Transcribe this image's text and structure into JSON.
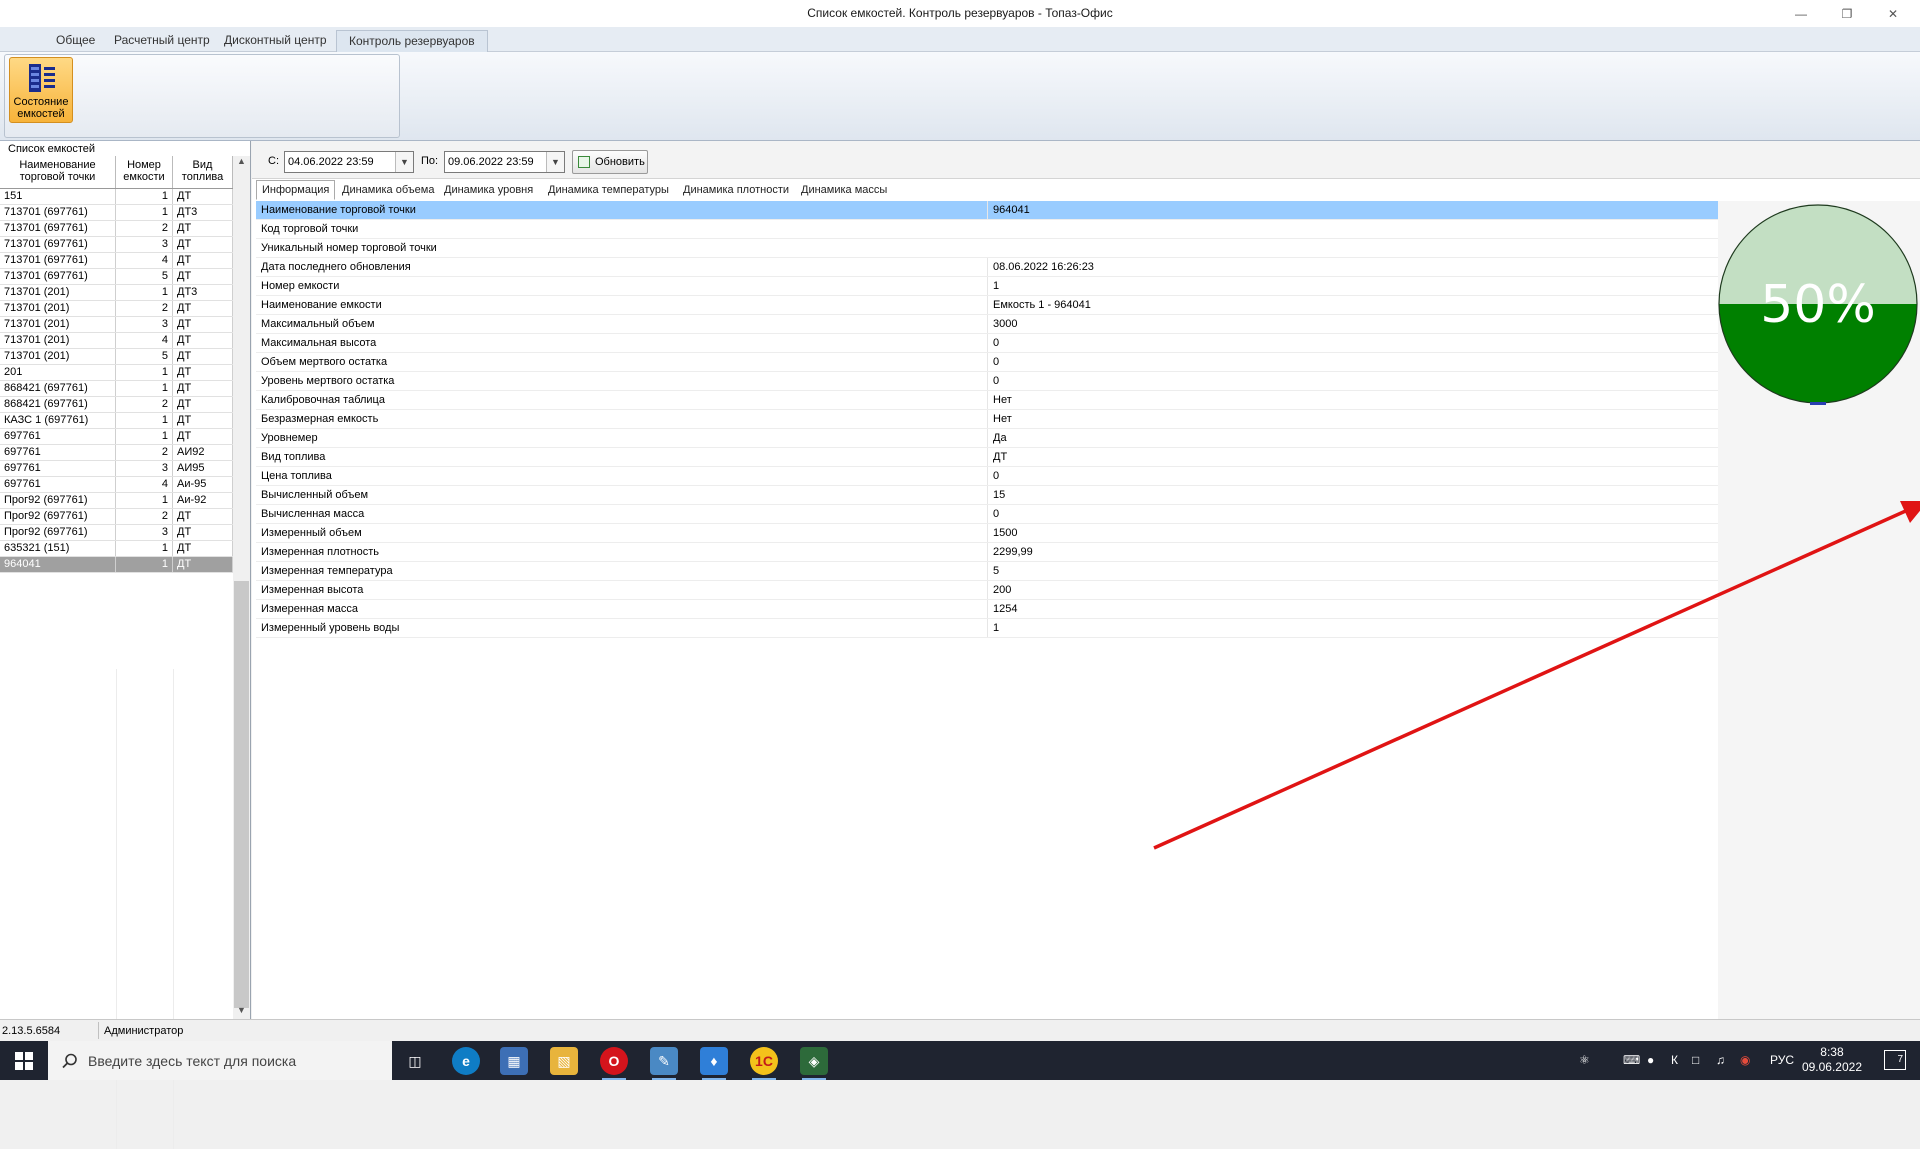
{
  "window": {
    "title": "Список емкостей. Контроль резервуаров - Топаз-Офис"
  },
  "ribbon_tabs": [
    "Общее",
    "Расчетный центр",
    "Дисконтный центр",
    "Контроль резервуаров"
  ],
  "ribbon": {
    "state_button": "Состояние емкостей"
  },
  "tank_list": {
    "caption": "Список емкостей",
    "headers": [
      "Наименование торговой точки",
      "Номер емкости",
      "Вид топлива"
    ],
    "rows": [
      [
        "151",
        "1",
        "ДТ"
      ],
      [
        "713701 (697761)",
        "1",
        "ДТ3"
      ],
      [
        "713701 (697761)",
        "2",
        "ДТ"
      ],
      [
        "713701 (697761)",
        "3",
        "ДТ"
      ],
      [
        "713701 (697761)",
        "4",
        "ДТ"
      ],
      [
        "713701 (697761)",
        "5",
        "ДТ"
      ],
      [
        "713701 (201)",
        "1",
        "ДТ3"
      ],
      [
        "713701 (201)",
        "2",
        "ДТ"
      ],
      [
        "713701 (201)",
        "3",
        "ДТ"
      ],
      [
        "713701 (201)",
        "4",
        "ДТ"
      ],
      [
        "713701 (201)",
        "5",
        "ДТ"
      ],
      [
        "201",
        "1",
        "ДТ"
      ],
      [
        "868421 (697761)",
        "1",
        "ДТ"
      ],
      [
        "868421 (697761)",
        "2",
        "ДТ"
      ],
      [
        "КАЗС 1 (697761)",
        "1",
        "ДТ"
      ],
      [
        "697761",
        "1",
        "ДТ"
      ],
      [
        "697761",
        "2",
        "АИ92"
      ],
      [
        "697761",
        "3",
        "АИ95"
      ],
      [
        "697761",
        "4",
        "Аи-95"
      ],
      [
        "Прог92 (697761)",
        "1",
        "Аи-92"
      ],
      [
        "Прог92 (697761)",
        "2",
        "ДТ"
      ],
      [
        "Прог92 (697761)",
        "3",
        "ДТ"
      ],
      [
        "635321 (151)",
        "1",
        "ДТ"
      ],
      [
        "964041",
        "1",
        "ДТ"
      ]
    ],
    "selected_index": 23
  },
  "filter": {
    "from_label": "С:",
    "from_value": "04.06.2022 23:59",
    "to_label": "По:",
    "to_value": "09.06.2022 23:59",
    "refresh_label": "Обновить"
  },
  "info_tabs": [
    "Информация",
    "Динамика объема",
    "Динамика уровня",
    "Динамика температуры",
    "Динамика плотности",
    "Динамика массы"
  ],
  "properties": [
    [
      "Наименование торговой точки",
      "964041"
    ],
    [
      "Код торговой точки",
      ""
    ],
    [
      "Уникальный номер торговой точки",
      ""
    ],
    [
      "Дата последнего обновления",
      "08.06.2022 16:26:23"
    ],
    [
      "Номер емкости",
      "1"
    ],
    [
      "Наименование емкости",
      "Емкость 1 - 964041"
    ],
    [
      "Максимальный объем",
      "3000"
    ],
    [
      "Максимальная высота",
      "0"
    ],
    [
      "Объем мертвого остатка",
      "0"
    ],
    [
      "Уровень мертвого остатка",
      "0"
    ],
    [
      "Калибровочная таблица",
      "Нет"
    ],
    [
      "Безразмерная емкость",
      "Нет"
    ],
    [
      "Уровнемер",
      "Да"
    ],
    [
      "Вид топлива",
      "ДТ"
    ],
    [
      "Цена топлива",
      "0"
    ],
    [
      "Вычисленный объем",
      "15"
    ],
    [
      "Вычисленная масса",
      "0"
    ],
    [
      "Измеренный объем",
      "1500"
    ],
    [
      "Измеренная плотность",
      "2299,99"
    ],
    [
      "Измеренная температура",
      "5"
    ],
    [
      "Измеренная высота",
      "200"
    ],
    [
      "Измеренная масса",
      "1254"
    ],
    [
      "Измеренный уровень воды",
      "1"
    ]
  ],
  "gauge": {
    "label": "50%",
    "fill_fraction": 0.5,
    "fill_color": "#008000",
    "empty_color": "#c3dfc3"
  },
  "status": {
    "version": "2.13.5.6584",
    "user": "Администратор"
  },
  "taskbar": {
    "search_placeholder": "Введите здесь текст для поиска",
    "lang": "РУС",
    "time": "8:38",
    "date": "09.06.2022",
    "notifications": "7"
  }
}
